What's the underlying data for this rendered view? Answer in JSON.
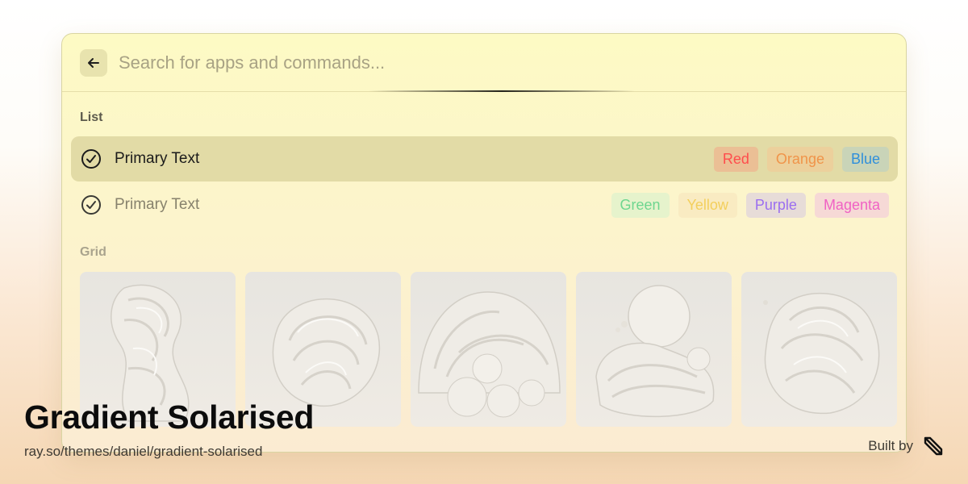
{
  "search": {
    "placeholder": "Search for apps and commands...",
    "back_icon": "arrow-left-icon"
  },
  "sections": {
    "list_title": "List",
    "grid_title": "Grid"
  },
  "list_items": [
    {
      "label": "Primary Text",
      "icon": "check-circle-icon",
      "selected": true,
      "tags": [
        {
          "label": "Red",
          "color": "#ff4d4d",
          "bg": "#ebbf95"
        },
        {
          "label": "Orange",
          "color": "#f0944a",
          "bg": "#ecd09c"
        },
        {
          "label": "Blue",
          "color": "#2f8fdb",
          "bg": "#c9d4b8"
        }
      ]
    },
    {
      "label": "Primary Text",
      "icon": "check-circle-icon",
      "selected": false,
      "tags": [
        {
          "label": "Green",
          "color": "#6ed68f",
          "bg": "#e6f3cc"
        },
        {
          "label": "Yellow",
          "color": "#f3cf5c",
          "bg": "#f9ebc2"
        },
        {
          "label": "Purple",
          "color": "#9b6ef0",
          "bg": "#e7dcd8"
        },
        {
          "label": "Magenta",
          "color": "#f062c4",
          "bg": "#f6d9d6"
        }
      ]
    }
  ],
  "grid_items": [
    {
      "name": "swirl-sculpture-1"
    },
    {
      "name": "swirl-sculpture-2"
    },
    {
      "name": "swirl-sculpture-3"
    },
    {
      "name": "swirl-sculpture-4"
    },
    {
      "name": "swirl-sculpture-5"
    }
  ],
  "footer": {
    "title": "Gradient Solarised",
    "url": "ray.so/themes/daniel/gradient-solarised",
    "built_by": "Built by",
    "logo_icon": "raycast-logo-icon"
  }
}
